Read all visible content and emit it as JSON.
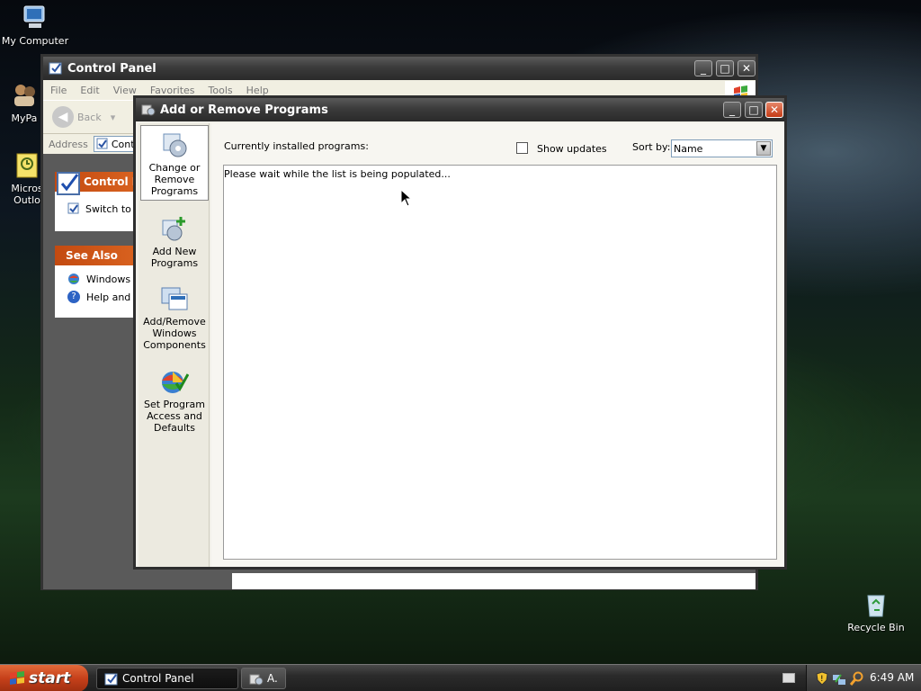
{
  "desktop": {
    "icons": [
      {
        "label": "My Computer"
      },
      {
        "label": "MyPa"
      },
      {
        "label": "Micros Outlo"
      },
      {
        "label": "Recycle Bin"
      }
    ]
  },
  "control_panel": {
    "title": "Control Panel",
    "menu": [
      "File",
      "Edit",
      "View",
      "Favorites",
      "Tools",
      "Help"
    ],
    "back_label": "Back",
    "address_label": "Address",
    "address_value": "Contr",
    "panel_title": "Control Pa",
    "switch_link": "Switch to C",
    "see_also_title": "See Also",
    "see_also_items": [
      "Windows U",
      "Help and S"
    ]
  },
  "arp": {
    "title": "Add or Remove Programs",
    "sidebar": [
      {
        "label": "Change or Remove Programs"
      },
      {
        "label": "Add New Programs"
      },
      {
        "label": "Add/Remove Windows Components"
      },
      {
        "label": "Set Program Access and Defaults"
      }
    ],
    "installed_label": "Currently installed programs:",
    "show_updates_label": "Show updates",
    "sort_by_label": "Sort by:",
    "sort_value": "Name",
    "list_message": "Please wait while the list is being populated..."
  },
  "taskbar": {
    "start_label": "start",
    "tasks": [
      {
        "label": "Control Panel"
      },
      {
        "label": "A."
      }
    ],
    "clock": "6:49 AM"
  }
}
